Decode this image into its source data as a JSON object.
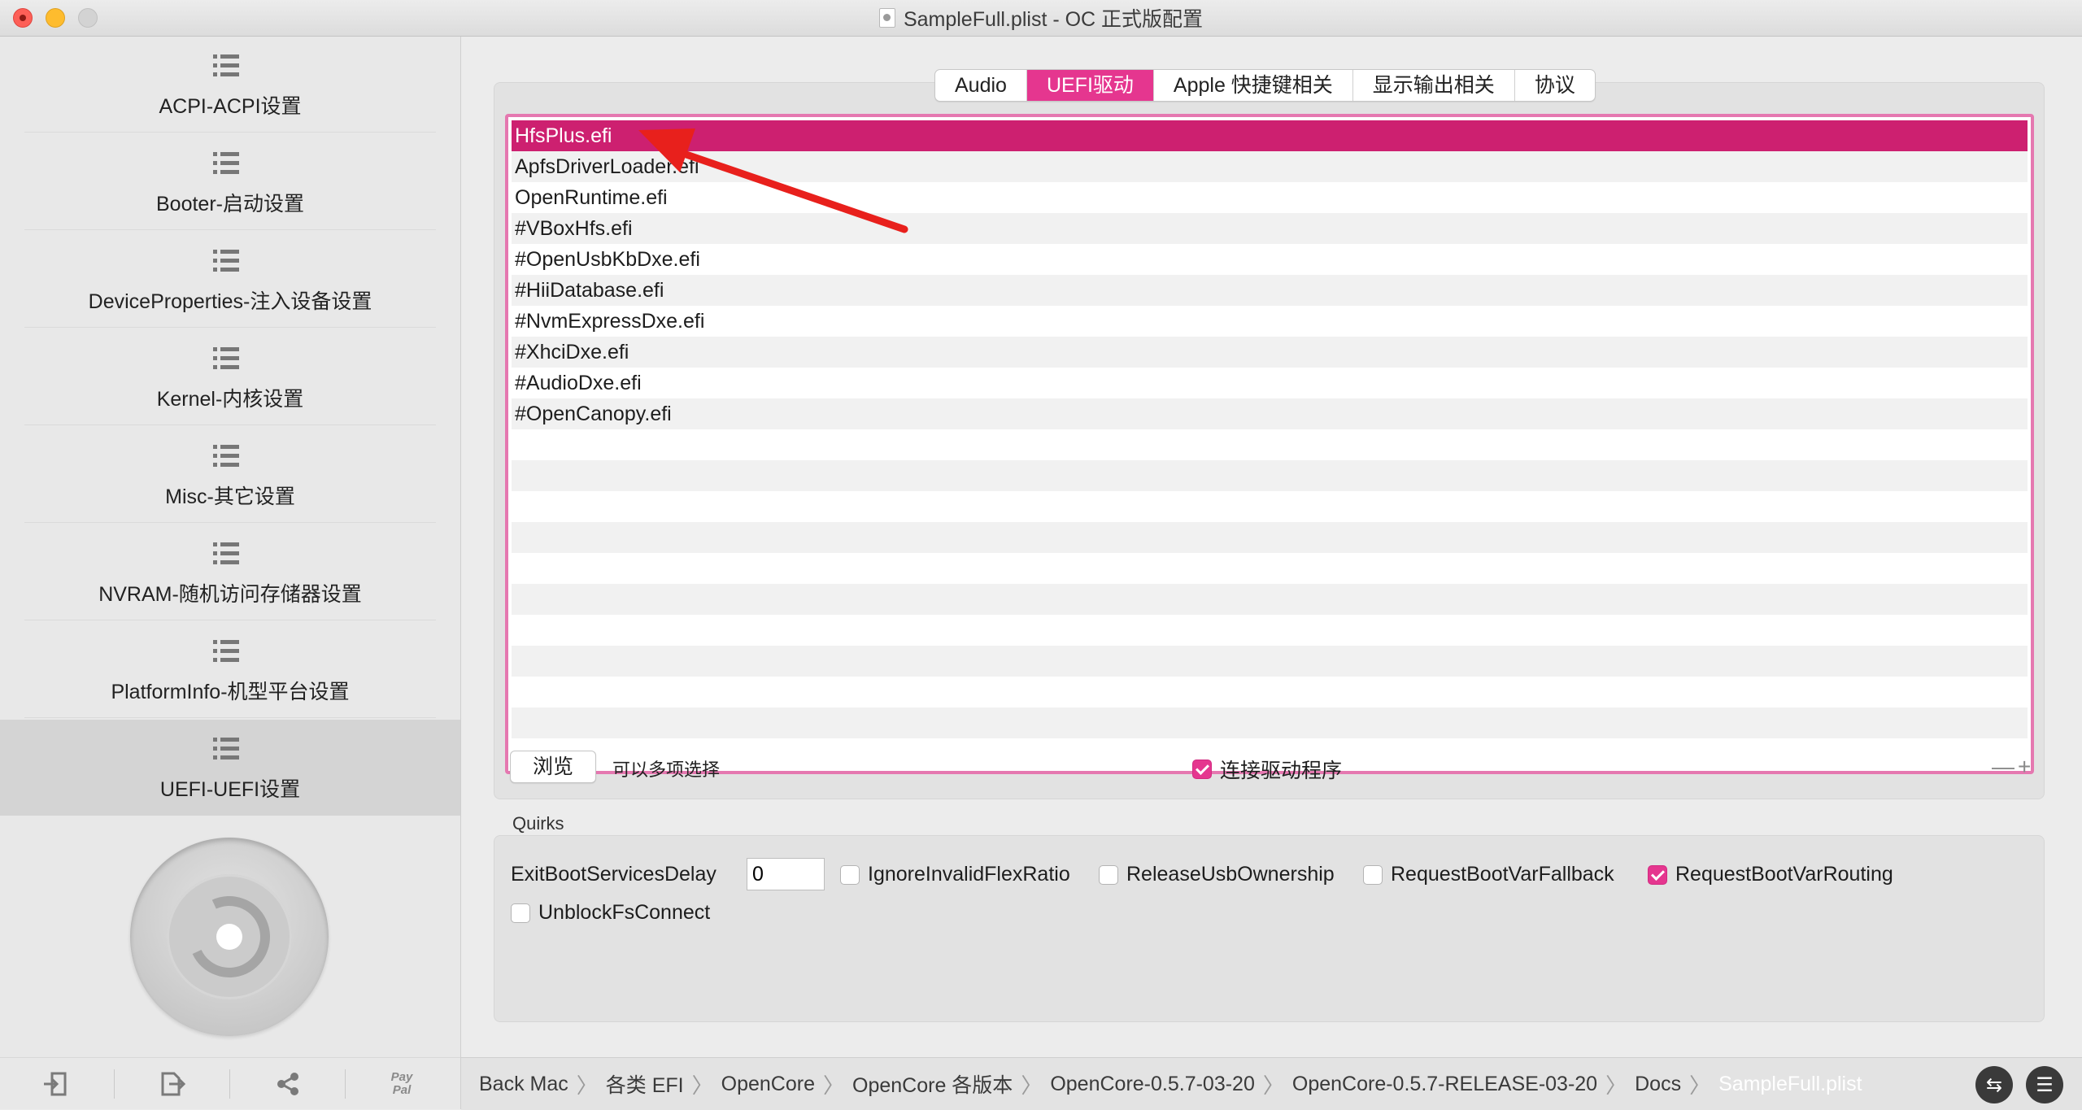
{
  "window": {
    "title": "SampleFull.plist - OC 正式版配置"
  },
  "sidebar": {
    "items": [
      {
        "label": "ACPI-ACPI设置"
      },
      {
        "label": "Booter-启动设置"
      },
      {
        "label": "DeviceProperties-注入设备设置"
      },
      {
        "label": "Kernel-内核设置"
      },
      {
        "label": "Misc-其它设置"
      },
      {
        "label": "NVRAM-随机访问存储器设置"
      },
      {
        "label": "PlatformInfo-机型平台设置"
      },
      {
        "label": "UEFI-UEFI设置"
      }
    ],
    "active_index": 7,
    "bottom_buttons": [
      {
        "icon": "import-icon"
      },
      {
        "icon": "export-icon"
      },
      {
        "icon": "share-icon"
      },
      {
        "icon": "paypal-icon",
        "text": "Pay Pal"
      }
    ]
  },
  "tabs": {
    "items": [
      "Audio",
      "UEFI驱动",
      "Apple 快捷键相关",
      "显示输出相关",
      "协议"
    ],
    "active_index": 1
  },
  "drivers": {
    "rows": [
      "HfsPlus.efi",
      "ApfsDriverLoader.efi",
      "OpenRuntime.efi",
      "#VBoxHfs.efi",
      "#OpenUsbKbDxe.efi",
      "#HiiDatabase.efi",
      "#NvmExpressDxe.efi",
      "#XhciDxe.efi",
      "#AudioDxe.efi",
      "#OpenCanopy.efi"
    ],
    "selected_index": 0,
    "browse_label": "浏览",
    "multi_select_label": "可以多项选择",
    "connect_drivers": {
      "label": "连接驱动程序",
      "checked": true
    },
    "remove_symbol": "—",
    "add_symbol": "+"
  },
  "quirks": {
    "title": "Quirks",
    "exit_boot_services_delay": {
      "label": "ExitBootServicesDelay",
      "value": "0"
    },
    "checkboxes": [
      {
        "label": "IgnoreInvalidFlexRatio",
        "checked": false
      },
      {
        "label": "ReleaseUsbOwnership",
        "checked": false
      },
      {
        "label": "RequestBootVarFallback",
        "checked": false
      },
      {
        "label": "RequestBootVarRouting",
        "checked": true
      },
      {
        "label": "UnblockFsConnect",
        "checked": false
      }
    ]
  },
  "pathbar": {
    "crumbs": [
      "Back Mac",
      "各类 EFI",
      "OpenCore",
      "OpenCore 各版本",
      "OpenCore-0.5.7-03-20",
      "OpenCore-0.5.7-RELEASE-03-20",
      "Docs",
      "SampleFull.plist"
    ]
  },
  "colors": {
    "accent": "#e5368f",
    "selection": "#cd2070",
    "arrow": "#e8201c"
  }
}
